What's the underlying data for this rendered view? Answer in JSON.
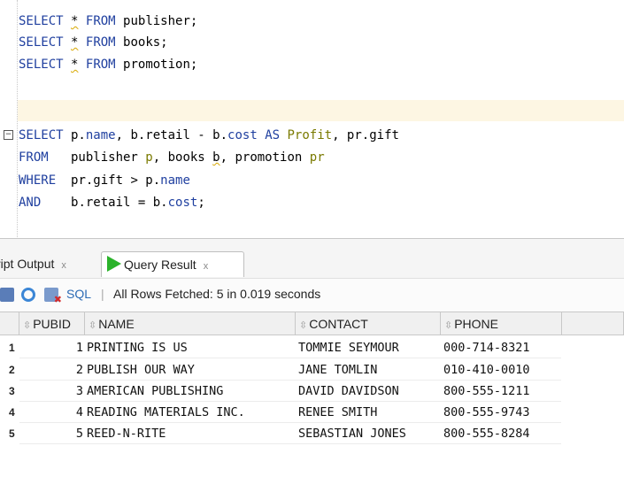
{
  "editor": {
    "lines": [
      {
        "parts": [
          [
            "kw",
            "SELECT"
          ],
          [
            "p",
            " "
          ],
          [
            "star",
            "*"
          ],
          [
            "p",
            " "
          ],
          [
            "kw",
            "FROM"
          ],
          [
            "p",
            " publisher;"
          ]
        ]
      },
      {
        "parts": [
          [
            "kw",
            "SELECT"
          ],
          [
            "p",
            " "
          ],
          [
            "star",
            "*"
          ],
          [
            "p",
            " "
          ],
          [
            "kw",
            "FROM"
          ],
          [
            "p",
            " books;"
          ]
        ]
      },
      {
        "parts": [
          [
            "kw",
            "SELECT"
          ],
          [
            "p",
            " "
          ],
          [
            "star",
            "*"
          ],
          [
            "p",
            " "
          ],
          [
            "kw",
            "FROM"
          ],
          [
            "p",
            " promotion;"
          ]
        ]
      },
      {
        "parts": []
      },
      {
        "parts": []
      },
      {
        "parts": [
          [
            "kw",
            "SELECT"
          ],
          [
            "p",
            " p."
          ],
          [
            "id",
            "name"
          ],
          [
            "p",
            ", b.retail - b."
          ],
          [
            "id",
            "cost"
          ],
          [
            "p",
            " "
          ],
          [
            "kw",
            "AS"
          ],
          [
            "p",
            " "
          ],
          [
            "alias",
            "Profit"
          ],
          [
            "p",
            ", pr.gift"
          ]
        ]
      },
      {
        "parts": [
          [
            "kw",
            "FROM"
          ],
          [
            "p",
            "   publisher "
          ],
          [
            "alias",
            "p"
          ],
          [
            "p",
            ", books "
          ],
          [
            "squig",
            "b"
          ],
          [
            "p",
            ", promotion "
          ],
          [
            "alias",
            "pr"
          ]
        ]
      },
      {
        "parts": [
          [
            "kw",
            "WHERE"
          ],
          [
            "p",
            "  pr.gift > p."
          ],
          [
            "id",
            "name"
          ]
        ]
      },
      {
        "parts": [
          [
            "kw",
            "AND"
          ],
          [
            "p",
            "    b.retail = b."
          ],
          [
            "id",
            "cost"
          ],
          [
            "p",
            ";"
          ]
        ]
      }
    ],
    "fold_glyph": "−"
  },
  "tabs": {
    "script_output": "ript Output",
    "query_result": "Query Result",
    "close_glyph": "x"
  },
  "toolbar": {
    "sql_label": "SQL",
    "separator": "|",
    "status": "All Rows Fetched: 5 in 0.019 seconds"
  },
  "grid": {
    "columns": [
      "PUBID",
      "NAME",
      "CONTACT",
      "PHONE"
    ],
    "rows": [
      {
        "num": "1",
        "pubid": "1",
        "name": "PRINTING IS US",
        "contact": "TOMMIE SEYMOUR",
        "phone": "000-714-8321"
      },
      {
        "num": "2",
        "pubid": "2",
        "name": "PUBLISH OUR WAY",
        "contact": "JANE TOMLIN",
        "phone": "010-410-0010"
      },
      {
        "num": "3",
        "pubid": "3",
        "name": "AMERICAN PUBLISHING",
        "contact": "DAVID DAVIDSON",
        "phone": "800-555-1211"
      },
      {
        "num": "4",
        "pubid": "4",
        "name": "READING MATERIALS INC.",
        "contact": "RENEE SMITH",
        "phone": "800-555-9743"
      },
      {
        "num": "5",
        "pubid": "5",
        "name": "REED-N-RITE",
        "contact": "SEBASTIAN JONES",
        "phone": "800-555-8284"
      }
    ]
  }
}
